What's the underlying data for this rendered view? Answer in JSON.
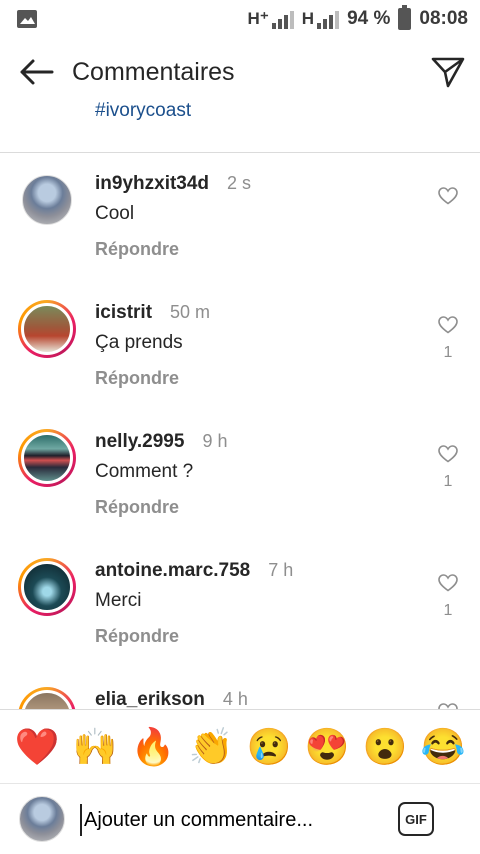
{
  "status_bar": {
    "network_1": "H⁺",
    "network_2": "H",
    "battery": "94 %",
    "time": "08:08"
  },
  "header": {
    "title": "Commentaires"
  },
  "caption_tail": "#ivorycoast",
  "comments": [
    {
      "username": "in9yhzxit34d",
      "time": "2 s",
      "text": "Cool",
      "reply": "Répondre",
      "likes": ""
    },
    {
      "username": "icistrit",
      "time": "50 m",
      "text": "Ça prends",
      "reply": "Répondre",
      "likes": "1"
    },
    {
      "username": "nelly.2995",
      "time": "9 h",
      "text": "Comment ?",
      "reply": "Répondre",
      "likes": "1"
    },
    {
      "username": "antoine.marc.758",
      "time": "7 h",
      "text": "Merci",
      "reply": "Répondre",
      "likes": "1"
    },
    {
      "username": "elia_erikson",
      "time": "4 h",
      "text": "",
      "reply": "",
      "likes": ""
    }
  ],
  "emoji_bar": [
    "❤️",
    "🙌",
    "🔥",
    "👏",
    "😢",
    "😍",
    "😮",
    "😂"
  ],
  "compose": {
    "placeholder": "Ajouter un commentaire...",
    "gif_label": "GIF"
  },
  "colors": {
    "hashtag": "#1b4f8c",
    "muted": "#8e8e8e",
    "text": "#262626"
  }
}
